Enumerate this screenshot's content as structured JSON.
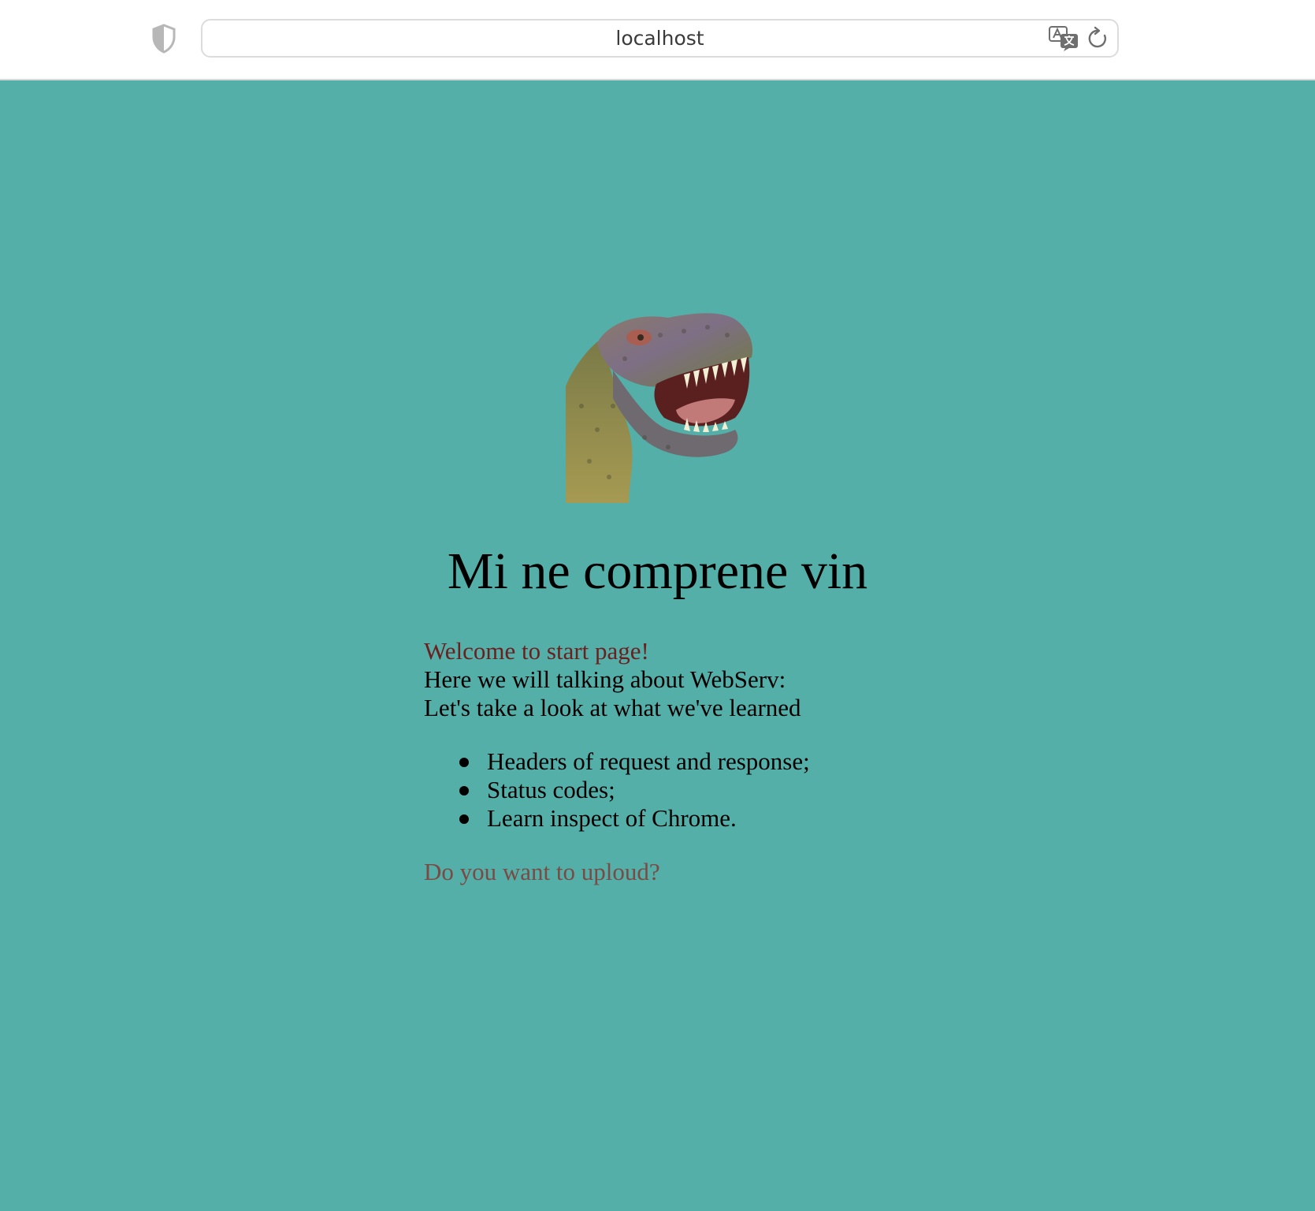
{
  "browser": {
    "address": "localhost"
  },
  "page": {
    "title": "Mi ne comprene vin",
    "welcome": "Welcome to start page!",
    "intro_line_1": "Here we will talking about WebServ:",
    "intro_line_2": "Let's take a look at what we've learned",
    "learned_items": [
      "Headers of request and response;",
      "Status codes;",
      "Learn inspect of Chrome."
    ],
    "upload_link": "Do you want to uploud?"
  },
  "colors": {
    "background": "#54afa8",
    "welcome_text": "#6b2020",
    "link_text": "#7a4a45"
  },
  "icons": {
    "privacy": "shield-icon",
    "translate": "translate-icon",
    "reload": "reload-icon",
    "image": "t-rex-dinosaur-image"
  }
}
